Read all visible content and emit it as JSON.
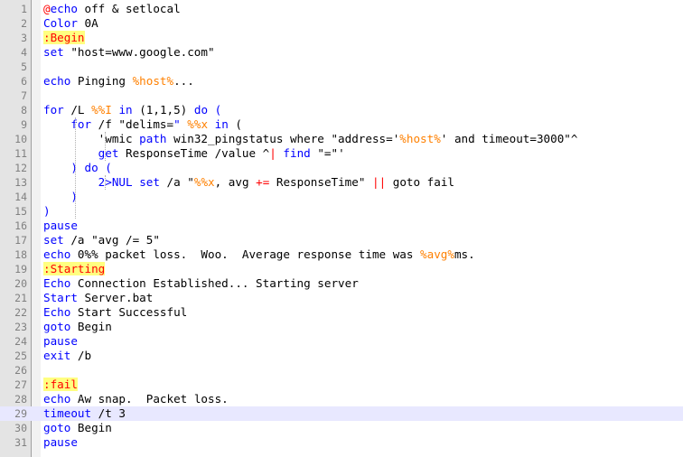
{
  "colors": {
    "keyword": "#0000ff",
    "variable": "#ff8000",
    "operator": "#ff0000",
    "label_text": "#ff0000",
    "label_bg": "#ffff80",
    "current_line": "#e8e8ff",
    "gutter_bg": "#e4e4e4"
  },
  "current_line": 29,
  "lines": [
    {
      "n": "1",
      "t": [
        {
          "c": "at",
          "s": "@"
        },
        {
          "c": "cmd",
          "s": "echo"
        },
        {
          "s": " off & setlocal"
        }
      ]
    },
    {
      "n": "2",
      "t": [
        {
          "c": "cmd",
          "s": "Color"
        },
        {
          "s": " 0A"
        }
      ]
    },
    {
      "n": "3",
      "t": [
        {
          "c": "lbl",
          "s": ":Begin"
        }
      ]
    },
    {
      "n": "4",
      "t": [
        {
          "c": "cmd",
          "s": "set"
        },
        {
          "s": " \"host=www.google.com\""
        }
      ]
    },
    {
      "n": "5",
      "t": []
    },
    {
      "n": "6",
      "t": [
        {
          "c": "cmd",
          "s": "echo"
        },
        {
          "s": " Pinging "
        },
        {
          "c": "var",
          "s": "%host%"
        },
        {
          "s": "..."
        }
      ]
    },
    {
      "n": "7",
      "t": []
    },
    {
      "n": "8",
      "t": [
        {
          "c": "cmd",
          "s": "for"
        },
        {
          "s": " /L "
        },
        {
          "c": "var",
          "s": "%%I"
        },
        {
          "s": " "
        },
        {
          "c": "cmd",
          "s": "in"
        },
        {
          "s": " (1,1,5) "
        },
        {
          "c": "cmd",
          "s": "do"
        },
        {
          "s": " "
        },
        {
          "c": "cmd",
          "s": "("
        }
      ]
    },
    {
      "n": "9",
      "t": [
        {
          "s": "    "
        },
        {
          "c": "cmd",
          "s": "for"
        },
        {
          "s": " /f \"delims="
        },
        {
          "c": "cmd",
          "s": "\""
        },
        {
          "s": " "
        },
        {
          "c": "var",
          "s": "%%x"
        },
        {
          "s": " "
        },
        {
          "c": "cmd",
          "s": "in"
        },
        {
          "s": " ("
        }
      ]
    },
    {
      "n": "10",
      "t": [
        {
          "s": "        'wmic "
        },
        {
          "c": "cmd",
          "s": "path"
        },
        {
          "s": " win32_pingstatus where \"address='"
        },
        {
          "c": "var",
          "s": "%host%"
        },
        {
          "s": "' and timeout=3000\"^"
        }
      ]
    },
    {
      "n": "11",
      "t": [
        {
          "s": "        "
        },
        {
          "c": "cmd",
          "s": "get"
        },
        {
          "s": " ResponseTime /value ^"
        },
        {
          "c": "op",
          "s": "|"
        },
        {
          "s": " "
        },
        {
          "c": "cmd",
          "s": "find"
        },
        {
          "s": " \"=\"'"
        }
      ]
    },
    {
      "n": "12",
      "t": [
        {
          "s": "    "
        },
        {
          "c": "cmd",
          "s": ")"
        },
        {
          "s": " "
        },
        {
          "c": "cmd",
          "s": "do"
        },
        {
          "s": " "
        },
        {
          "c": "cmd",
          "s": "("
        }
      ]
    },
    {
      "n": "13",
      "t": [
        {
          "s": "        "
        },
        {
          "c": "cmd",
          "s": "2>NUL"
        },
        {
          "s": " "
        },
        {
          "c": "cmd",
          "s": "set"
        },
        {
          "s": " /a \""
        },
        {
          "c": "var",
          "s": "%%x"
        },
        {
          "s": ", avg "
        },
        {
          "c": "op",
          "s": "+="
        },
        {
          "s": " ResponseTime\" "
        },
        {
          "c": "op",
          "s": "||"
        },
        {
          "s": " goto fail"
        }
      ]
    },
    {
      "n": "14",
      "t": [
        {
          "s": "    "
        },
        {
          "c": "cmd",
          "s": ")"
        }
      ]
    },
    {
      "n": "15",
      "t": [
        {
          "c": "cmd",
          "s": ")"
        }
      ]
    },
    {
      "n": "16",
      "t": [
        {
          "c": "cmd",
          "s": "pause"
        }
      ]
    },
    {
      "n": "17",
      "t": [
        {
          "c": "cmd",
          "s": "set"
        },
        {
          "s": " /a \"avg /= 5\""
        }
      ]
    },
    {
      "n": "18",
      "t": [
        {
          "c": "cmd",
          "s": "echo"
        },
        {
          "s": " 0%% packet loss.  Woo.  Average response time was "
        },
        {
          "c": "var",
          "s": "%avg%"
        },
        {
          "s": "ms."
        }
      ]
    },
    {
      "n": "19",
      "t": [
        {
          "c": "lbl",
          "s": ":Starting"
        }
      ]
    },
    {
      "n": "20",
      "t": [
        {
          "c": "cmd",
          "s": "Echo"
        },
        {
          "s": " Connection Established... Starting server"
        }
      ]
    },
    {
      "n": "21",
      "t": [
        {
          "c": "cmd",
          "s": "Start"
        },
        {
          "s": " Server.bat"
        }
      ]
    },
    {
      "n": "22",
      "t": [
        {
          "c": "cmd",
          "s": "Echo"
        },
        {
          "s": " Start Successful"
        }
      ]
    },
    {
      "n": "23",
      "t": [
        {
          "c": "cmd",
          "s": "goto"
        },
        {
          "s": " Begin"
        }
      ]
    },
    {
      "n": "24",
      "t": [
        {
          "c": "cmd",
          "s": "pause"
        }
      ]
    },
    {
      "n": "25",
      "t": [
        {
          "c": "cmd",
          "s": "exit"
        },
        {
          "s": " /b"
        }
      ]
    },
    {
      "n": "26",
      "t": []
    },
    {
      "n": "27",
      "t": [
        {
          "c": "lbl",
          "s": ":fail"
        }
      ]
    },
    {
      "n": "28",
      "t": [
        {
          "c": "cmd",
          "s": "echo"
        },
        {
          "s": " Aw snap.  Packet loss."
        }
      ]
    },
    {
      "n": "29",
      "t": [
        {
          "c": "cmd",
          "s": "timeout"
        },
        {
          "s": " /t 3"
        }
      ]
    },
    {
      "n": "30",
      "t": [
        {
          "c": "cmd",
          "s": "goto"
        },
        {
          "s": " Begin"
        }
      ]
    },
    {
      "n": "31",
      "t": [
        {
          "c": "cmd",
          "s": "pause"
        }
      ]
    }
  ]
}
